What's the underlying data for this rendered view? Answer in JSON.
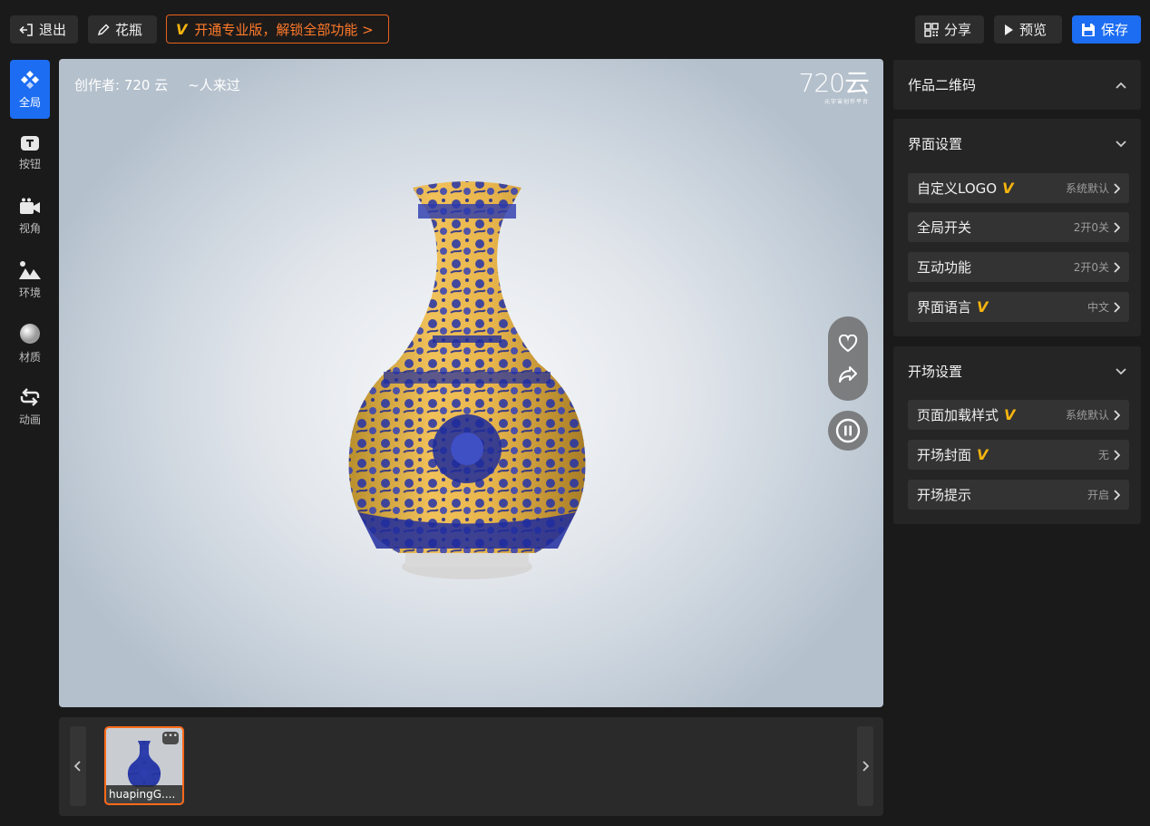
{
  "topbar": {
    "exit_label": "退出",
    "title": "花瓶",
    "promo_label": "开通专业版，解锁全部功能 >",
    "promo_badge": "V",
    "share_label": "分享",
    "preview_label": "预览",
    "save_label": "保存"
  },
  "sidebar": {
    "items": [
      {
        "label": "全局",
        "icon": "global-icon",
        "active": true
      },
      {
        "label": "按钮",
        "icon": "button-icon"
      },
      {
        "label": "视角",
        "icon": "camera-icon"
      },
      {
        "label": "环境",
        "icon": "mountain-icon"
      },
      {
        "label": "材质",
        "icon": "sphere-icon"
      },
      {
        "label": "动画",
        "icon": "loop-icon"
      }
    ]
  },
  "viewer": {
    "creator": "创作者: 720 云",
    "visitors": "~人来过",
    "brand": "720云",
    "brand_sub": "元宇宙创作平台"
  },
  "tray": {
    "thumb_label": "huapingG...."
  },
  "panels": {
    "qr": {
      "title": "作品二维码"
    },
    "interface": {
      "title": "界面设置",
      "rows": [
        {
          "label": "自定义LOGO",
          "pro": true,
          "value": "系统默认"
        },
        {
          "label": "全局开关",
          "value": "2开0关"
        },
        {
          "label": "互动功能",
          "value": "2开0关"
        },
        {
          "label": "界面语言",
          "pro": true,
          "value": "中文"
        }
      ]
    },
    "opening": {
      "title": "开场设置",
      "rows": [
        {
          "label": "页面加载样式",
          "pro": true,
          "value": "系统默认"
        },
        {
          "label": "开场封面",
          "pro": true,
          "value": "无"
        },
        {
          "label": "开场提示",
          "value": "开启"
        }
      ]
    }
  },
  "colors": {
    "accent": "#1c6df2",
    "promo": "#ff7a2a",
    "pro_badge": "#f5b40f"
  }
}
